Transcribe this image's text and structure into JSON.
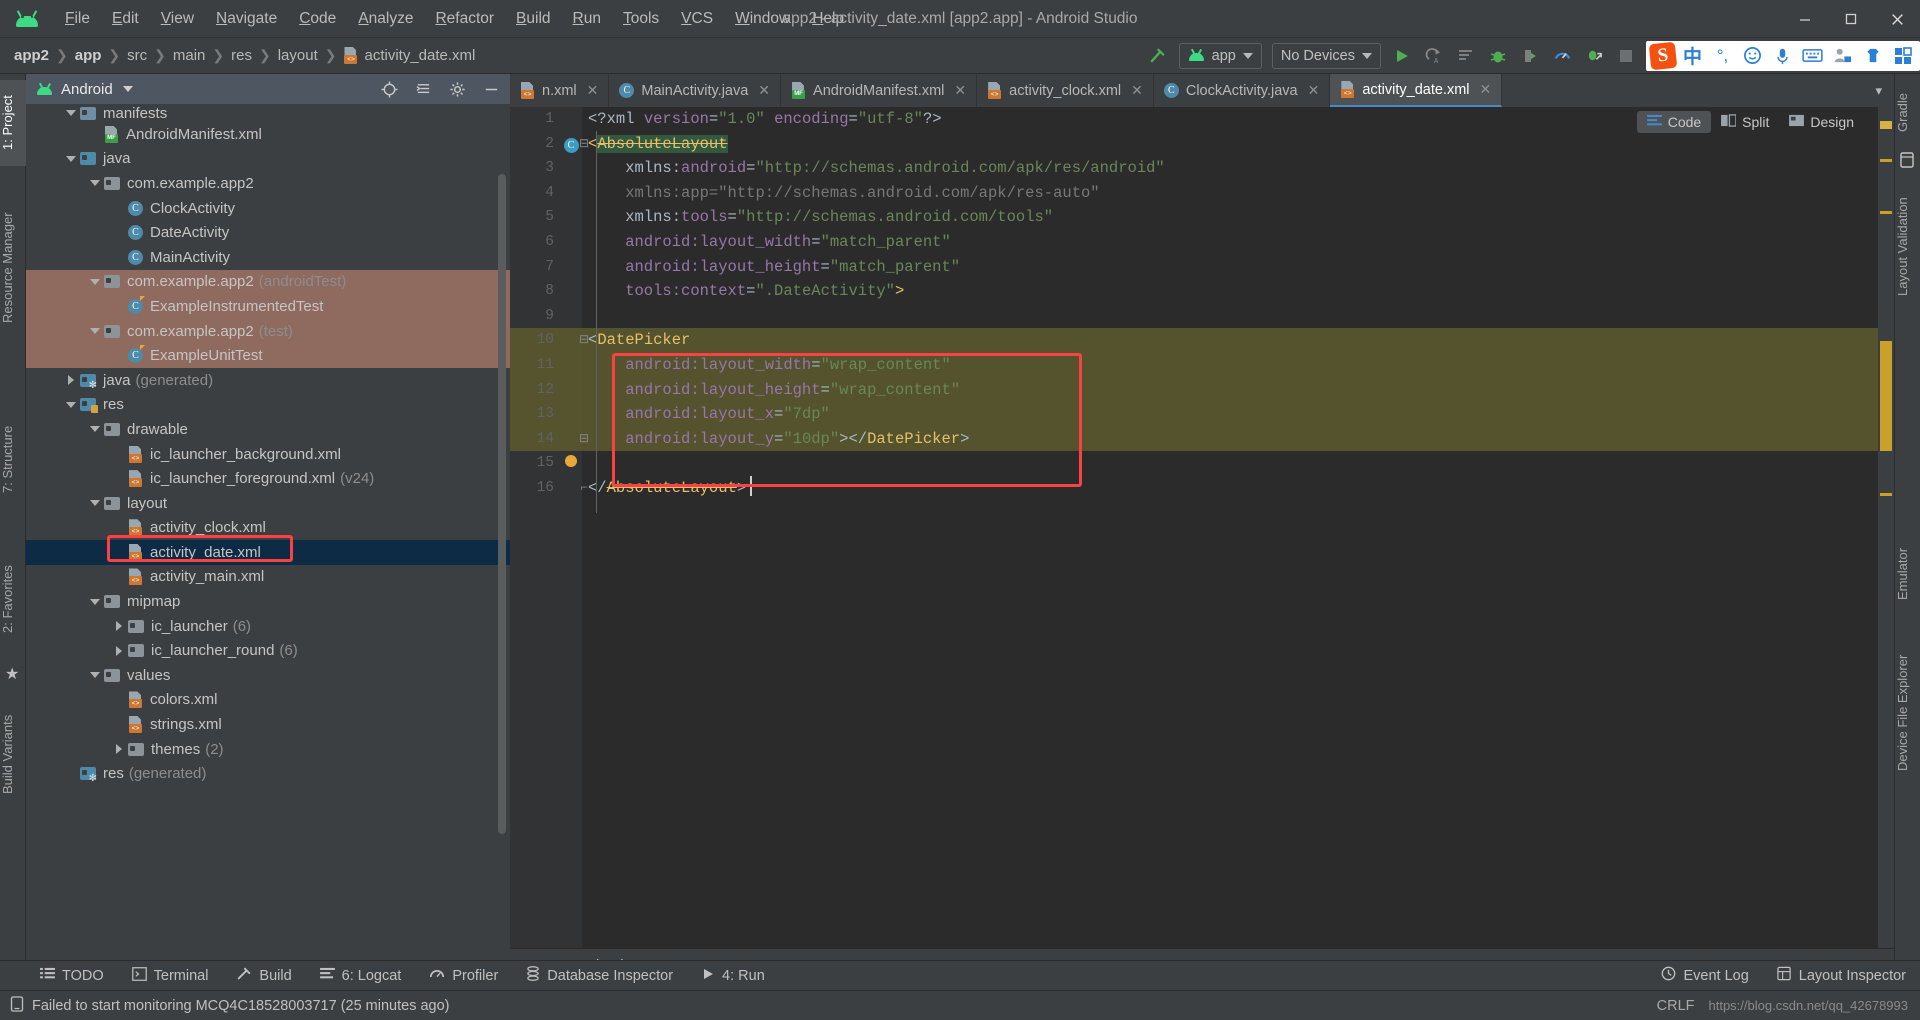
{
  "window": {
    "title": "app2 - activity_date.xml [app2.app] - Android Studio",
    "logo_icon": "android-logo-icon",
    "minimize_icon": "minimize-icon",
    "maximize_icon": "maximize-icon",
    "close_icon": "close-icon"
  },
  "menu": [
    {
      "label": "File"
    },
    {
      "label": "Edit"
    },
    {
      "label": "View"
    },
    {
      "label": "Navigate"
    },
    {
      "label": "Code"
    },
    {
      "label": "Analyze"
    },
    {
      "label": "Refactor"
    },
    {
      "label": "Build"
    },
    {
      "label": "Run"
    },
    {
      "label": "Tools"
    },
    {
      "label": "VCS"
    },
    {
      "label": "Window"
    },
    {
      "label": "Help"
    }
  ],
  "toolbar": {
    "breadcrumb": [
      "app2",
      "app",
      "src",
      "main",
      "res",
      "layout",
      "activity_date.xml"
    ],
    "module_selector": "app",
    "device_selector": "No Devices",
    "run_icon": "run-icon",
    "rerun_icon": "apply-changes-icon",
    "stop_icon": "apply-code-changes-icon",
    "debug_icon": "debug-icon",
    "attach_debugger_icon": "attach-debugger-icon",
    "profiler_icon": "profiler-icon",
    "run_with_coverage_icon": "profile-app-icon",
    "avd_icon": "avd-manager-icon",
    "build_icon": "build-hammer-icon",
    "ime": {
      "logo": "S",
      "mode": "中",
      "punct_icon": "punctuation-icon",
      "emoji_icon": "emoji-icon",
      "mic_icon": "microphone-icon",
      "keyboard_icon": "keyboard-icon",
      "user_icon": "user-icon",
      "skin_icon": "skin-icon",
      "apps_icon": "apps-grid-icon"
    }
  },
  "left_tool_strip": [
    {
      "label": "1: Project",
      "selected": true
    },
    {
      "label": "Resource Manager",
      "selected": false
    },
    {
      "label": "7: Structure",
      "selected": false
    },
    {
      "label": "2: Favorites",
      "selected": false
    },
    {
      "label": "Build Variants",
      "selected": false
    }
  ],
  "right_tool_strip": [
    {
      "label": "Gradle"
    },
    {
      "label": "Layout Validation"
    },
    {
      "label": "Emulator"
    },
    {
      "label": "Device File Explorer"
    }
  ],
  "project_panel": {
    "title": "Android",
    "dropdown_icon": "chevron-down-icon",
    "locate_icon": "locate-target-icon",
    "collapse_icon": "collapse-all-icon",
    "settings_icon": "gear-icon",
    "hide_icon": "hide-panel-icon",
    "tree": [
      {
        "label": "manifests",
        "depth": 1,
        "type": "folder",
        "twisty": "down",
        "partial": true
      },
      {
        "label": "AndroidManifest.xml",
        "depth": 2,
        "type": "manifest",
        "twisty": "none"
      },
      {
        "label": "java",
        "depth": 1,
        "type": "folder-blue",
        "twisty": "down"
      },
      {
        "label": "com.example.app2",
        "depth": 2,
        "type": "folder-gray",
        "twisty": "down"
      },
      {
        "label": "ClockActivity",
        "depth": 3,
        "type": "class",
        "twisty": "none"
      },
      {
        "label": "DateActivity",
        "depth": 3,
        "type": "class",
        "twisty": "none"
      },
      {
        "label": "MainActivity",
        "depth": 3,
        "type": "class",
        "twisty": "none"
      },
      {
        "label": "com.example.app2",
        "suffix": "(androidTest)",
        "depth": 2,
        "type": "folder-gray",
        "twisty": "down",
        "scope": "test"
      },
      {
        "label": "ExampleInstrumentedTest",
        "depth": 3,
        "type": "class-test",
        "twisty": "none",
        "scope": "test"
      },
      {
        "label": "com.example.app2",
        "suffix": "(test)",
        "depth": 2,
        "type": "folder-gray",
        "twisty": "down",
        "scope": "test"
      },
      {
        "label": "ExampleUnitTest",
        "depth": 3,
        "type": "class-test",
        "twisty": "none",
        "scope": "test"
      },
      {
        "label": "java",
        "suffix": "(generated)",
        "depth": 1,
        "type": "folder-gen",
        "twisty": "right"
      },
      {
        "label": "res",
        "depth": 1,
        "type": "folder-res",
        "twisty": "down"
      },
      {
        "label": "drawable",
        "depth": 2,
        "type": "folder-gray",
        "twisty": "down"
      },
      {
        "label": "ic_launcher_background.xml",
        "depth": 3,
        "type": "xml",
        "twisty": "none"
      },
      {
        "label": "ic_launcher_foreground.xml",
        "suffix": "(v24)",
        "depth": 3,
        "type": "xml",
        "twisty": "none"
      },
      {
        "label": "layout",
        "depth": 2,
        "type": "folder-gray",
        "twisty": "down"
      },
      {
        "label": "activity_clock.xml",
        "depth": 3,
        "type": "xml",
        "twisty": "none"
      },
      {
        "label": "activity_date.xml",
        "depth": 3,
        "type": "xml",
        "twisty": "none",
        "selected": true,
        "annotated": true
      },
      {
        "label": "activity_main.xml",
        "depth": 3,
        "type": "xml",
        "twisty": "none"
      },
      {
        "label": "mipmap",
        "depth": 2,
        "type": "folder-gray",
        "twisty": "down"
      },
      {
        "label": "ic_launcher",
        "suffix": "(6)",
        "depth": 3,
        "type": "folder-gray",
        "twisty": "right"
      },
      {
        "label": "ic_launcher_round",
        "suffix": "(6)",
        "depth": 3,
        "type": "folder-gray",
        "twisty": "right"
      },
      {
        "label": "values",
        "depth": 2,
        "type": "folder-gray",
        "twisty": "down"
      },
      {
        "label": "colors.xml",
        "depth": 3,
        "type": "xml",
        "twisty": "none"
      },
      {
        "label": "strings.xml",
        "depth": 3,
        "type": "xml",
        "twisty": "none"
      },
      {
        "label": "themes",
        "suffix": "(2)",
        "depth": 3,
        "type": "folder-gray",
        "twisty": "right"
      },
      {
        "label": "res",
        "suffix": "(generated)",
        "depth": 1,
        "type": "folder-gen",
        "twisty": "none"
      }
    ]
  },
  "editor": {
    "tabs": [
      {
        "label": "n.xml",
        "icon": "xml-icon",
        "active": false,
        "clipped": true
      },
      {
        "label": "MainActivity.java",
        "icon": "class-icon",
        "active": false
      },
      {
        "label": "AndroidManifest.xml",
        "icon": "manifest-icon",
        "active": false
      },
      {
        "label": "activity_clock.xml",
        "icon": "xml-icon",
        "active": false
      },
      {
        "label": "ClockActivity.java",
        "icon": "class-icon",
        "active": false
      },
      {
        "label": "activity_date.xml",
        "icon": "xml-icon",
        "active": true
      }
    ],
    "tab_overflow_icon": "chevron-down-icon",
    "view_modes": [
      {
        "label": "Code",
        "icon": "code-icon",
        "active": true
      },
      {
        "label": "Split",
        "icon": "split-icon",
        "active": false
      },
      {
        "label": "Design",
        "icon": "design-icon",
        "active": false
      }
    ],
    "status_text": "AbsoluteLayout",
    "lines": [
      {
        "n": 1,
        "tokens": [
          {
            "t": "<?xml ",
            "c": "k-punct"
          },
          {
            "t": "version",
            "c": "k-attr"
          },
          {
            "t": "=",
            "c": "k-punct"
          },
          {
            "t": "\"1.0\"",
            "c": "k-str"
          },
          {
            "t": " ",
            "c": "k-punct"
          },
          {
            "t": "encoding",
            "c": "k-attr"
          },
          {
            "t": "=",
            "c": "k-punct"
          },
          {
            "t": "\"utf-8\"",
            "c": "k-str"
          },
          {
            "t": "?>",
            "c": "k-punct"
          }
        ]
      },
      {
        "n": 2,
        "gutter": "class-marker",
        "fold": "fold-collapse",
        "tokens": [
          {
            "t": "<",
            "c": "k-tag"
          },
          {
            "t": "AbsoluteLayout",
            "c": "k-strike hl-ident"
          }
        ]
      },
      {
        "n": 3,
        "tokens": [
          {
            "t": "    xmlns:",
            "c": "k-punct"
          },
          {
            "t": "android",
            "c": "k-attr"
          },
          {
            "t": "=",
            "c": "k-punct"
          },
          {
            "t": "\"http://schemas.android.com/apk/res/android\"",
            "c": "k-str"
          }
        ]
      },
      {
        "n": 4,
        "dim": true,
        "tokens": [
          {
            "t": "    xmlns:",
            "c": "k-dim"
          },
          {
            "t": "app",
            "c": "k-dim"
          },
          {
            "t": "=",
            "c": "k-dim"
          },
          {
            "t": "\"http://schemas.android.com/apk/res-auto\"",
            "c": "k-dim"
          }
        ]
      },
      {
        "n": 5,
        "tokens": [
          {
            "t": "    xmlns:",
            "c": "k-punct"
          },
          {
            "t": "tools",
            "c": "k-attr"
          },
          {
            "t": "=",
            "c": "k-punct"
          },
          {
            "t": "\"http://schemas.android.com/tools\"",
            "c": "k-str"
          }
        ]
      },
      {
        "n": 6,
        "tokens": [
          {
            "t": "    android:layout_width",
            "c": "k-attr"
          },
          {
            "t": "=",
            "c": "k-punct"
          },
          {
            "t": "\"match_parent\"",
            "c": "k-str"
          }
        ]
      },
      {
        "n": 7,
        "tokens": [
          {
            "t": "    android:layout_height",
            "c": "k-attr"
          },
          {
            "t": "=",
            "c": "k-punct"
          },
          {
            "t": "\"match_parent\"",
            "c": "k-str"
          }
        ]
      },
      {
        "n": 8,
        "tokens": [
          {
            "t": "    tools:context",
            "c": "k-attr"
          },
          {
            "t": "=",
            "c": "k-punct"
          },
          {
            "t": "\".DateActivity\"",
            "c": "k-str"
          },
          {
            "t": ">",
            "c": "k-tag"
          }
        ]
      },
      {
        "n": 9,
        "tokens": []
      },
      {
        "n": 10,
        "fold": "fold-collapse",
        "highlight": true,
        "tokens": [
          {
            "t": "<",
            "c": "k-punct"
          },
          {
            "t": "DatePicker",
            "c": "k-tag"
          }
        ]
      },
      {
        "n": 11,
        "highlight": true,
        "tokens": [
          {
            "t": "    android:layout_width",
            "c": "k-attr"
          },
          {
            "t": "=",
            "c": "k-punct"
          },
          {
            "t": "\"wrap_content\"",
            "c": "k-str"
          }
        ]
      },
      {
        "n": 12,
        "highlight": true,
        "tokens": [
          {
            "t": "    android:layout_height",
            "c": "k-attr"
          },
          {
            "t": "=",
            "c": "k-punct"
          },
          {
            "t": "\"wrap_content\"",
            "c": "k-str"
          }
        ]
      },
      {
        "n": 13,
        "highlight": true,
        "tokens": [
          {
            "t": "    android:layout_x",
            "c": "k-attr"
          },
          {
            "t": "=",
            "c": "k-punct"
          },
          {
            "t": "\"7dp\"",
            "c": "k-str"
          }
        ]
      },
      {
        "n": 14,
        "highlight": true,
        "fold": "fold-collapse",
        "tokens": [
          {
            "t": "    android:layout_y",
            "c": "k-attr"
          },
          {
            "t": "=",
            "c": "k-punct"
          },
          {
            "t": "\"10dp\"",
            "c": "k-str"
          },
          {
            "t": "></",
            "c": "k-punct"
          },
          {
            "t": "DatePicker",
            "c": "k-tag"
          },
          {
            "t": ">",
            "c": "k-punct"
          }
        ]
      },
      {
        "n": 15,
        "gutter": "intention-bulb",
        "tokens": []
      },
      {
        "n": 16,
        "fold": "fold-end",
        "tokens": [
          {
            "t": "</",
            "c": "k-punct"
          },
          {
            "t": "AbsoluteLayout",
            "c": "k-strike"
          },
          {
            "t": ">",
            "c": "k-punct"
          }
        ]
      }
    ]
  },
  "bottom_tools": [
    {
      "label": "TODO",
      "icon": "todo-icon"
    },
    {
      "label": "Terminal",
      "icon": "terminal-icon"
    },
    {
      "label": "Build",
      "icon": "build-hammer-icon"
    },
    {
      "label": "6: Logcat",
      "icon": "logcat-icon"
    },
    {
      "label": "Profiler",
      "icon": "profiler-icon"
    },
    {
      "label": "Database Inspector",
      "icon": "database-icon"
    },
    {
      "label": "4: Run",
      "icon": "run-icon"
    }
  ],
  "bottom_right_tools": [
    {
      "label": "Event Log",
      "icon": "event-log-icon"
    },
    {
      "label": "Layout Inspector",
      "icon": "layout-inspector-icon"
    }
  ],
  "status_bar": {
    "icon": "device-icon",
    "message": "Failed to start monitoring MCQ4C18528003717 (25 minutes ago)",
    "right_text": "CRLF",
    "watermark": "https://blog.csdn.net/qq_42678993"
  },
  "colors": {
    "accent_green": "#3ddc84",
    "annotation_red": "#fb4141",
    "selection_blue": "#0d2b45",
    "test_scope": "#8f6a5e",
    "editor_bg": "#2b2b2b",
    "panel_bg": "#3c3f41",
    "highlight_olive": "#5c5a2e"
  }
}
